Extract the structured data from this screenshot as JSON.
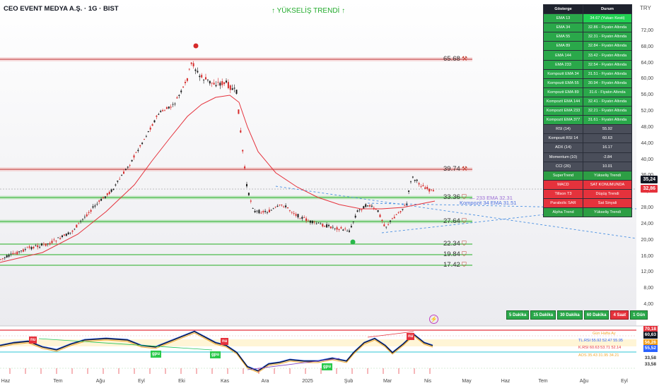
{
  "header": {
    "symbol_title": "CEO EVENT MEDYA A.Ş. · 1G · BIST",
    "trend_banner": "↑ YÜKSELİŞ TRENDİ ↑",
    "currency": "TRY"
  },
  "price_axis": {
    "ticks": [
      "72,00",
      "68,00",
      "64,00",
      "60,00",
      "56,00",
      "52,00",
      "48,00",
      "44,00",
      "40,00",
      "36,00",
      "32,00",
      "28,00",
      "24,00",
      "20,00",
      "16,00",
      "12,00",
      "8,00",
      "4,00"
    ],
    "last_price": "35,24",
    "ema_value": "32,86",
    "last_price_color": "#131722",
    "ema_value_color": "#e5323c"
  },
  "levels": [
    {
      "label": "65.68",
      "color": "#e48b8b",
      "type": "resistance"
    },
    {
      "label": "39.74",
      "color": "#e48b8b",
      "type": "resistance"
    },
    {
      "label": "33.36",
      "color": "#5bc45b",
      "type": "support"
    },
    {
      "label": "27.64",
      "color": "#5bc45b",
      "type": "support"
    },
    {
      "label": "22.34",
      "color": "#5bc45b",
      "type": "support"
    },
    {
      "label": "19.84",
      "color": "#5bc45b",
      "type": "support"
    },
    {
      "label": "17.42",
      "color": "#5bc45b",
      "type": "support"
    }
  ],
  "ema_labels": {
    "ema233": "— 233 EMA 32.31",
    "komp34": "Kompozit 34 EMA 31.51"
  },
  "status_table": {
    "headers": [
      "Gösterge",
      "Durum"
    ],
    "rows": [
      {
        "name": "EMA 13",
        "status": "34.67 (Yukarı Kesti)",
        "color": "bright"
      },
      {
        "name": "EMA 34",
        "status": "32.86  -  Fiyatın Altında",
        "color": "green"
      },
      {
        "name": "EMA 55",
        "status": "32.31  -  Fiyatın Altında",
        "color": "green"
      },
      {
        "name": "EMA 89",
        "status": "32.84  -  Fiyatın Altında",
        "color": "green"
      },
      {
        "name": "EMA 144",
        "status": "33.42  -  Fiyatın Altında",
        "color": "green"
      },
      {
        "name": "EMA 233",
        "status": "32.54  -  Fiyatın Altında",
        "color": "green"
      },
      {
        "name": "Kompozit EMA 34",
        "status": "31.51  -  Fiyatın Altında",
        "color": "green"
      },
      {
        "name": "Kompozit EMA 55",
        "status": "30.94  -  Fiyatın Altında",
        "color": "green"
      },
      {
        "name": "Kompozit EMA 89",
        "status": "31.6  -  Fiyatın Altında",
        "color": "green"
      },
      {
        "name": "Kompozit EMA 144",
        "status": "32.41  -  Fiyatın Altında",
        "color": "green"
      },
      {
        "name": "Kompozit EMA 233",
        "status": "32.21  -  Fiyatın Altında",
        "color": "green"
      },
      {
        "name": "Kompozit EMA 377",
        "status": "31.61  -  Fiyatın Altında",
        "color": "green"
      },
      {
        "name": "RSI (14)",
        "status": "55.92",
        "color": "gray"
      },
      {
        "name": "Kompozit RSI 14",
        "status": "60.63",
        "color": "gray"
      },
      {
        "name": "ADX (14)",
        "status": "16.17",
        "color": "gray"
      },
      {
        "name": "Momentum (10)",
        "status": "-2.84",
        "color": "gray"
      },
      {
        "name": "CCI (20)",
        "status": "10.01",
        "color": "gray"
      },
      {
        "name": "SuperTrend",
        "status": "Yükseliş Trendi",
        "color": "dkgreen"
      },
      {
        "name": "MACD",
        "status": "SAT KONUMUNDA",
        "color": "red"
      },
      {
        "name": "Tillson T3",
        "status": "Düşüş Trendi",
        "color": "red"
      },
      {
        "name": "Parabolic SAR",
        "status": "Sat Sinyali",
        "color": "red"
      },
      {
        "name": "Alpha Trend",
        "status": "Yükseliş Trendi",
        "color": "dkgreen"
      }
    ]
  },
  "timeframes": [
    {
      "label": "5 Dakika",
      "active": false
    },
    {
      "label": "15 Dakika",
      "active": false
    },
    {
      "label": "30 Dakika",
      "active": false
    },
    {
      "label": "60 Dakika",
      "active": false
    },
    {
      "label": "4 Saat",
      "active": true
    },
    {
      "label": "1 Gün",
      "active": false
    }
  ],
  "rsi_panel": {
    "legend": [
      {
        "text": "Gün  Hafta  Ay",
        "color": "#f0a830"
      },
      {
        "text": "TL.RSI  55.92  52.47  55.95",
        "color": "#2a62ff"
      },
      {
        "text": "K.RSI  60.63  53.71  52.14",
        "color": "#e5323c"
      },
      {
        "text": "AOS  35.43  31.95  34.21",
        "color": "#f0a830"
      }
    ],
    "tags": [
      {
        "value": "70,18",
        "color": "#e5323c"
      },
      {
        "value": "60,63",
        "color": "#131722"
      },
      {
        "value": "56,26",
        "color": "#f39c12"
      },
      {
        "value": "55,52",
        "color": "#2a62ff"
      },
      {
        "value": "33,58",
        "color": "#ffffff"
      },
      {
        "value": "33,58",
        "color": "#ffffff"
      }
    ],
    "badges": [
      {
        "text": "nu",
        "kind": "red"
      },
      {
        "text": "gpu",
        "kind": "green"
      },
      {
        "text": "gpu",
        "kind": "green"
      },
      {
        "text": "nu",
        "kind": "red"
      },
      {
        "text": "nu",
        "kind": "red"
      },
      {
        "text": "gpu",
        "kind": "green"
      }
    ]
  },
  "time_axis": [
    "Haz",
    "Tem",
    "Ağu",
    "Eyl",
    "Eki",
    "Kas",
    "Ara",
    "2025",
    "Şub",
    "Mar",
    "Nis",
    "May",
    "Haz",
    "Tem",
    "Ağu",
    "Eyl"
  ],
  "colors": {
    "up": "#26a69a",
    "down": "#ef5350",
    "candle_up": "#1b1b1b",
    "ema_line": "#e5323c",
    "resistance": "#e48b8b",
    "support": "#5bc45b",
    "trendline": "#4a90e2"
  }
}
